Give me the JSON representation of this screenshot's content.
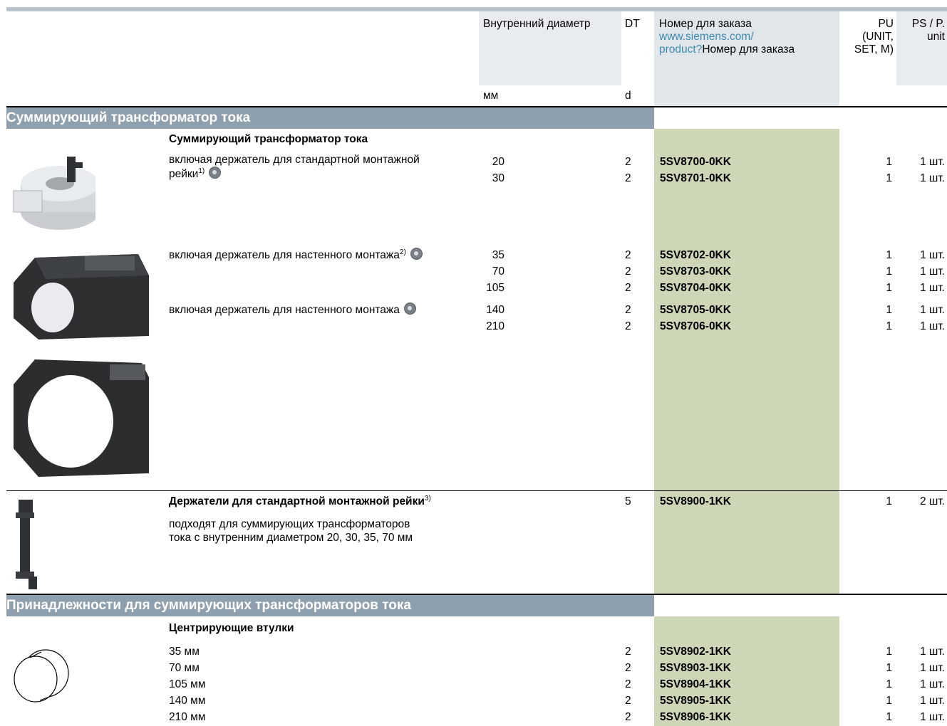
{
  "header": {
    "diameter_label": "Внутренний диаметр",
    "dt_label": "DT",
    "order_label": "Номер для заказа",
    "order_link_1": "www.siemens.com/",
    "order_link_2": "product?",
    "order_label_tail": "Номер для заказа",
    "pu_line1": "PU",
    "pu_line2": "(UNIT,",
    "pu_line3": "SET, M)",
    "ps_line1": "PS / P.",
    "ps_line2": "unit",
    "unit_mm": "мм",
    "unit_d": "d"
  },
  "section1": {
    "title": "Суммирующий трансформатор тока",
    "subtitle": "Суммирующий трансформатор тока",
    "desc_a_line1": "включая держатель для стандартной монтажной",
    "desc_a_line2": "рейки",
    "desc_a_sup": "1)",
    "desc_b": "включая держатель для настенного монтажа",
    "desc_b_sup": "2)",
    "desc_c": "включая держатель для настенного монтажа",
    "rows": [
      {
        "d": "20",
        "dt": "2",
        "order": "5SV8700-0KK",
        "pu": "1",
        "ps": "1 шт."
      },
      {
        "d": "30",
        "dt": "2",
        "order": "5SV8701-0KK",
        "pu": "1",
        "ps": "1 шт."
      },
      {
        "d": "35",
        "dt": "2",
        "order": "5SV8702-0KK",
        "pu": "1",
        "ps": "1 шт."
      },
      {
        "d": "70",
        "dt": "2",
        "order": "5SV8703-0KK",
        "pu": "1",
        "ps": "1 шт."
      },
      {
        "d": "105",
        "dt": "2",
        "order": "5SV8704-0KK",
        "pu": "1",
        "ps": "1 шт."
      },
      {
        "d": "140",
        "dt": "2",
        "order": "5SV8705-0KK",
        "pu": "1",
        "ps": "1 шт."
      },
      {
        "d": "210",
        "dt": "2",
        "order": "5SV8706-0KK",
        "pu": "1",
        "ps": "1 шт."
      }
    ],
    "holder_title": "Держатели для стандартной монтажной рейки",
    "holder_sup": "3)",
    "holder_desc_1": "подходят для суммирующих трансформаторов",
    "holder_desc_2": "тока с внутренним диаметром 20, 30, 35, 70 мм",
    "holder_row": {
      "dt": "5",
      "order": "5SV8900-1KK",
      "pu": "1",
      "ps": "2 шт."
    }
  },
  "section2": {
    "title": "Принадлежности для суммирующих трансформаторов тока",
    "subtitle": "Центрирующие втулки",
    "rows": [
      {
        "d": "35 мм",
        "dt": "2",
        "order": "5SV8902-1KK",
        "pu": "1",
        "ps": "1 шт."
      },
      {
        "d": "70 мм",
        "dt": "2",
        "order": "5SV8903-1KK",
        "pu": "1",
        "ps": "1 шт."
      },
      {
        "d": "105 мм",
        "dt": "2",
        "order": "5SV8904-1KK",
        "pu": "1",
        "ps": "1 шт."
      },
      {
        "d": "140 мм",
        "dt": "2",
        "order": "5SV8905-1KK",
        "pu": "1",
        "ps": "1 шт."
      },
      {
        "d": "210 мм",
        "dt": "2",
        "order": "5SV8906-1KK",
        "pu": "1",
        "ps": "1 шт."
      }
    ]
  },
  "icons": {
    "availability": "ring-icon"
  }
}
